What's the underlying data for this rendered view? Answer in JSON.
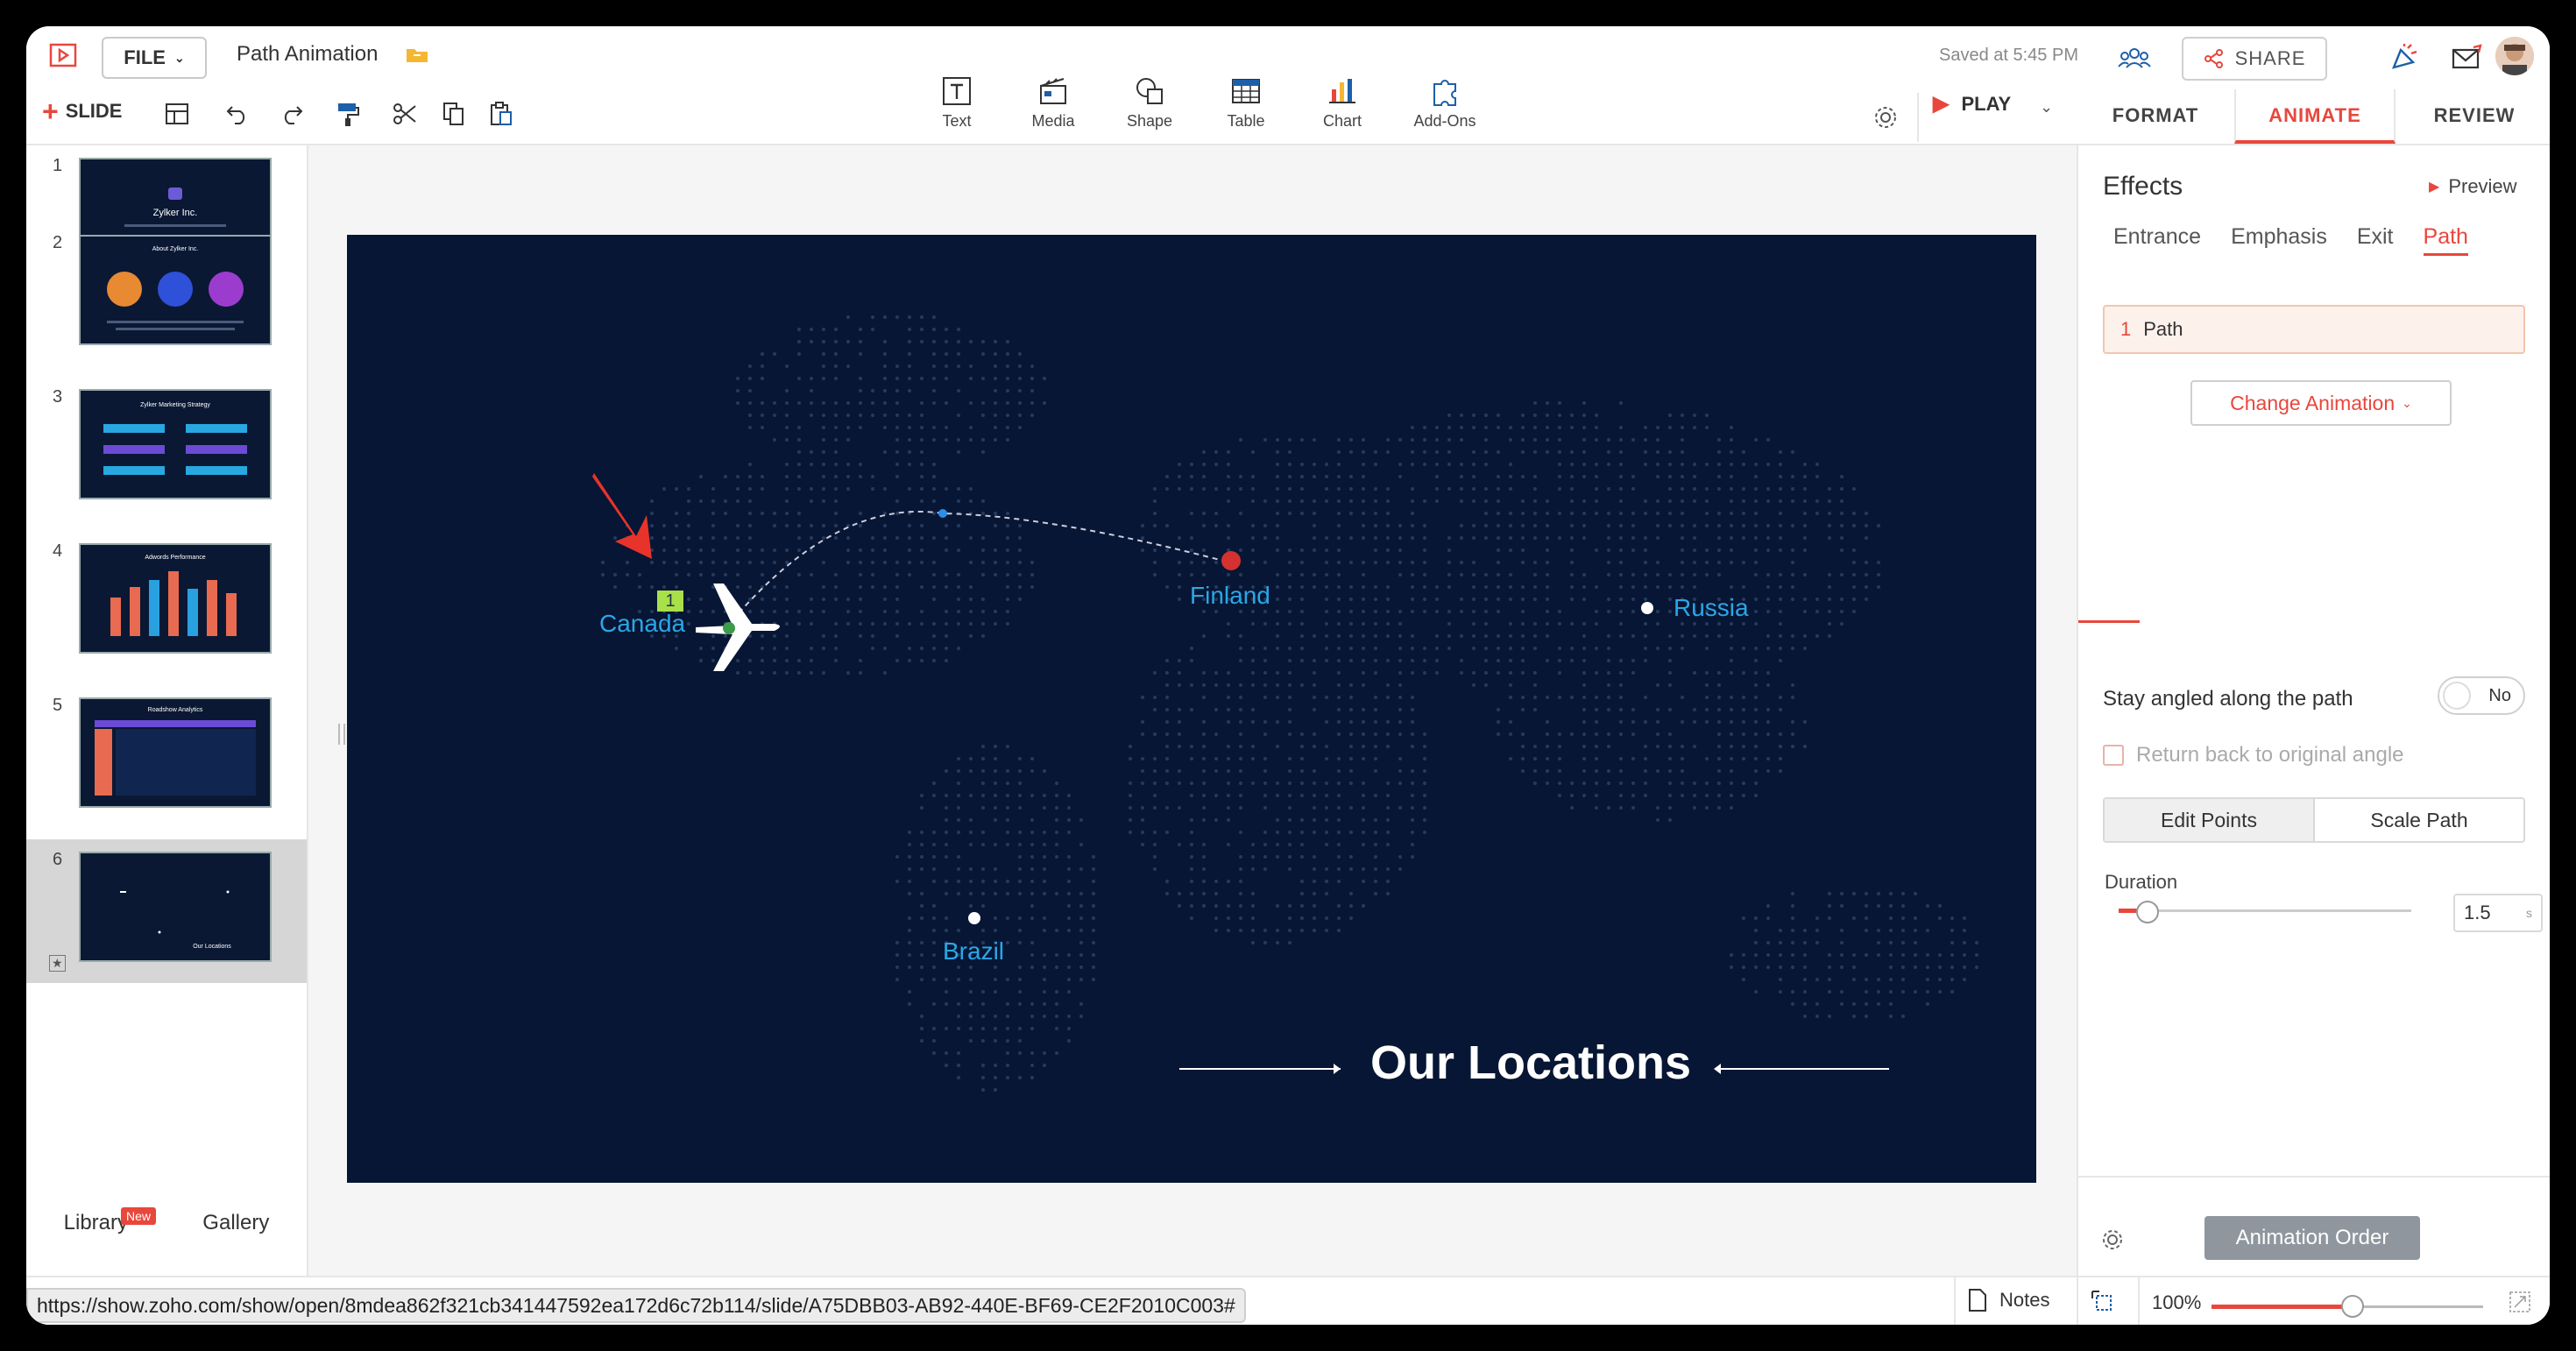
{
  "topbar": {
    "file_label": "FILE",
    "doc_title": "Path Animation",
    "saved_text": "Saved at 5:45 PM",
    "share_label": "SHARE",
    "slide_label": "SLIDE",
    "play_label": "PLAY",
    "insert_items": [
      {
        "label": "Text",
        "icon": "text-box-icon"
      },
      {
        "label": "Media",
        "icon": "clapperboard-icon"
      },
      {
        "label": "Shape",
        "icon": "shape-icon"
      },
      {
        "label": "Table",
        "icon": "table-icon"
      },
      {
        "label": "Chart",
        "icon": "bar-chart-icon"
      },
      {
        "label": "Add-Ons",
        "icon": "puzzle-icon"
      }
    ],
    "tabs": [
      "FORMAT",
      "ANIMATE",
      "REVIEW"
    ],
    "active_tab": "ANIMATE"
  },
  "slides_panel": {
    "numbers": [
      "1",
      "2",
      "3",
      "4",
      "5",
      "6"
    ],
    "active_slide": "6",
    "thumb_titles": [
      "Zylker Inc.",
      "About Zylker Inc.",
      "Zylker Marketing Strategy",
      "Adwords Performance",
      "Roadshow Analytics",
      "Our Locations"
    ],
    "library_label": "Library",
    "new_badge": "New",
    "gallery_label": "Gallery"
  },
  "slide": {
    "locations": {
      "canada": "Canada",
      "finland": "Finland",
      "russia": "Russia",
      "brazil": "Brazil"
    },
    "order_badge": "1",
    "heading": "Our Locations",
    "colors": {
      "background": "#071634",
      "label": "#2aa7e8"
    }
  },
  "right_panel": {
    "effects_title": "Effects",
    "preview_label": "Preview",
    "subtabs": [
      "Entrance",
      "Emphasis",
      "Exit",
      "Path"
    ],
    "active_subtab": "Path",
    "animation_item": {
      "index": "1",
      "name": "Path"
    },
    "change_animation": "Change Animation",
    "stay_angled_label": "Stay angled along the path",
    "toggle_value": "No",
    "return_label": "Return back to original angle",
    "segment": [
      "Edit Points",
      "Scale Path"
    ],
    "duration_label": "Duration",
    "duration_value": "1.5",
    "duration_unit": "s",
    "animation_order": "Animation Order"
  },
  "bottombar": {
    "url": "https://show.zoho.com/show/open/8mdea862f321cb341447592ea172d6c72b114/slide/A75DBB03-AB92-440E-BF69-CE2F2010C003#",
    "notes_label": "Notes",
    "zoom": "100%"
  },
  "accent_color": "#e8473c"
}
